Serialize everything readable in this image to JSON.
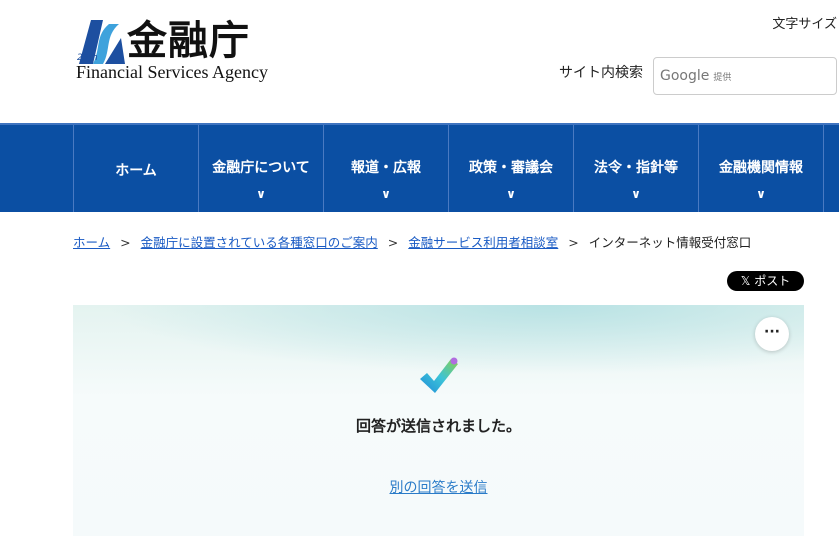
{
  "header": {
    "logo_kanji": "金融庁",
    "logo_en": "Financial Services Agency",
    "logo_badge": "25th",
    "text_size": "文字サイズ",
    "search_label": "サイト内検索",
    "search_placeholder": "Google",
    "search_provided": "提供"
  },
  "nav": [
    {
      "label": "ホーム"
    },
    {
      "label": "金融庁について"
    },
    {
      "label": "報道・広報"
    },
    {
      "label": "政策・審議会"
    },
    {
      "label": "法令・指針等"
    },
    {
      "label": "金融機関情報"
    }
  ],
  "breadcrumb": [
    "ホーム",
    "金融庁に設置されている各種窓口のご案内",
    "金融サービス利用者相談室",
    "インターネット情報受付窓口"
  ],
  "breadcrumb_sep": ">",
  "post_button": "𝕏 ポスト",
  "form": {
    "message": "回答が送信されました。",
    "again_link": "別の回答を送信",
    "more": "···"
  }
}
